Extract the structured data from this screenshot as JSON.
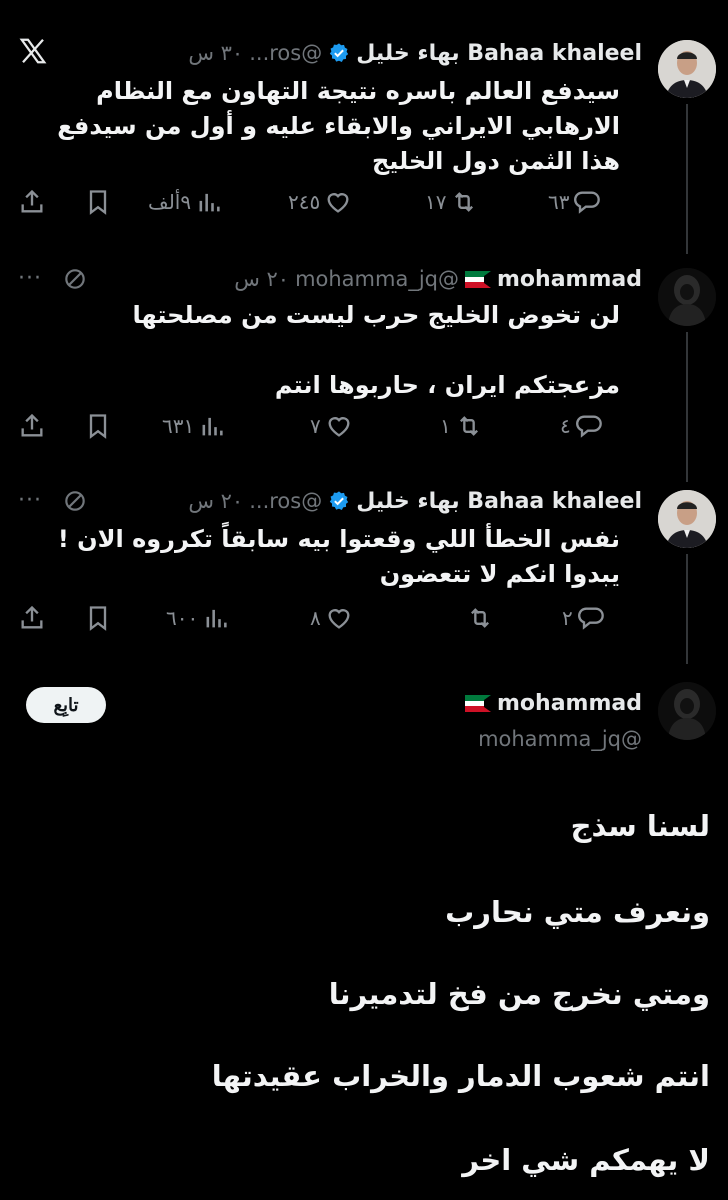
{
  "app_logo": "x-logo-icon",
  "tweets": [
    {
      "name": "Bahaa khaleel بهاء خليل",
      "handle": "@ros...",
      "time": "٣٠ س",
      "verified": true,
      "text": "سيدفع العالم باسره نتيجة التهاون مع النظام الارهابي الايراني والابقاء عليه و أول من سيدفع هذا الثمن دول الخليج",
      "replies": "٦٣",
      "reposts": "١٧",
      "likes": "٢٤٥",
      "views": "٩ألف"
    },
    {
      "name": "mohammad",
      "handle": "@mohamma_jq",
      "time": "٢٠ س",
      "text_line1": "لن تخوض الخليج حرب ليست من مصلحتها",
      "text_line2": "مزعجتكم ايران ، حاربوها انتم",
      "replies": "٤",
      "reposts": "١",
      "likes": "٧",
      "views": "٦٣١"
    },
    {
      "name": "Bahaa khaleel بهاء خليل",
      "handle": "@ros...",
      "time": "٢٠ س",
      "verified": true,
      "text": "نفس الخطأ اللي وقعتوا بيه سابقاً تكرروه الان ! يبدوا انكم لا تتعضون",
      "replies": "٢",
      "reposts": "",
      "likes": "٨",
      "views": "٦٠٠"
    }
  ],
  "main_post": {
    "name": "mohammad",
    "handle": "@mohamma_jq",
    "follow_label": "تابِع",
    "lines": [
      "لسنا سذج",
      "ونعرف متي نحارب",
      "ومتي نخرج من فخ لتدميرنا",
      "انتم شعوب الدمار والخراب عقيدتها",
      "لا يهمكم شي اخر"
    ]
  },
  "more_glyph": "···",
  "colors": {
    "background": "#000000",
    "text": "#e7e9ea",
    "muted": "#71767b",
    "verified": "#1d9bf0"
  }
}
